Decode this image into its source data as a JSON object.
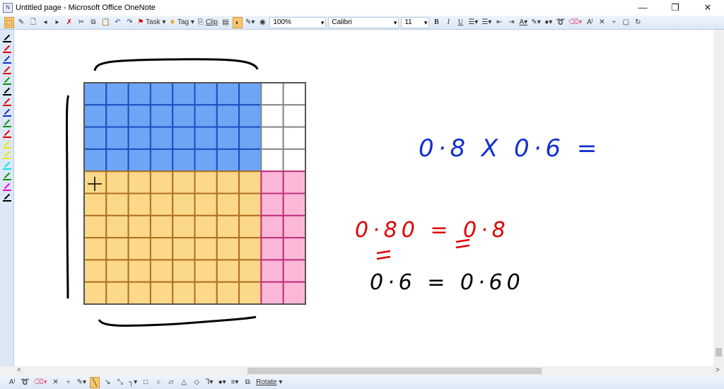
{
  "window": {
    "title": "Untitled page - Microsoft Office OneNote",
    "minimize": "—",
    "maximize": "❐",
    "close": "✕"
  },
  "toolbar": {
    "task": "Task",
    "tag": "Tag",
    "clip": "Clip",
    "zoom": "100%",
    "font": "Calibri",
    "size": "11",
    "bold": "B",
    "italic": "I",
    "underline": "U"
  },
  "bottom_toolbar": {
    "rotate": "Rotate"
  },
  "pen_colors": [
    "#000000",
    "#e00000",
    "#1030d0",
    "#e00000",
    "#109010",
    "#000000",
    "#e00000",
    "#1030d0",
    "#109010",
    "#e00000",
    "#e8e800",
    "#e8e800",
    "#10e0e0",
    "#109010",
    "#e800e8",
    "#000000"
  ],
  "grid": {
    "rows": 10,
    "cols": 10,
    "blue_cols": 8,
    "blue_rows": 4,
    "colors": {
      "blue": "#6ea6f5",
      "yellow": "#fcd98a",
      "pink": "#fab8d6",
      "white": "#ffffff"
    }
  },
  "notes": {
    "equation": "0·8 X 0·6 =",
    "line1": "0·80 = 0·8",
    "line2": "0·6 = 0·60"
  }
}
